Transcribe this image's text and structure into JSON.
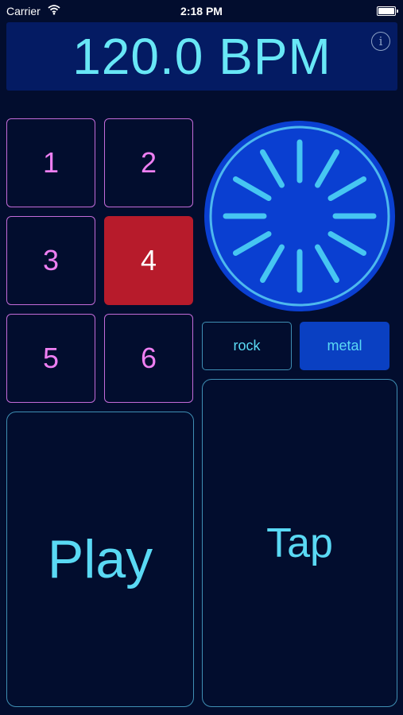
{
  "status_bar": {
    "carrier": "Carrier",
    "time": "2:18 PM",
    "wifi_icon": "wifi-icon",
    "battery_icon": "battery-icon"
  },
  "header": {
    "bpm": "120.0 BPM",
    "info_label": "i",
    "info_icon": "info-circle-icon"
  },
  "patterns": [
    {
      "label": "1",
      "active": false
    },
    {
      "label": "2",
      "active": false
    },
    {
      "label": "3",
      "active": false
    },
    {
      "label": "4",
      "active": true
    },
    {
      "label": "5",
      "active": false
    },
    {
      "label": "6",
      "active": false
    }
  ],
  "styles": [
    {
      "label": "rock",
      "selected": false
    },
    {
      "label": "metal",
      "selected": true
    }
  ],
  "dial": {
    "icon": "beat-spinner-icon",
    "tick_count": 12
  },
  "controls": {
    "play_label": "Play",
    "tap_label": "Tap"
  },
  "colors": {
    "background": "#020d2e",
    "header_bg": "#041b63",
    "bpm_text": "#68e7f6",
    "pad_border": "#c36bd9",
    "pad_text": "#ee7ff2",
    "active_pad": "#b71b2b",
    "control_border": "#3f8fb4",
    "control_text": "#5ad9f4",
    "selected_style": "#0a40c2",
    "dial_fill": "#0a3fd1",
    "dial_ring": "#4db8ee",
    "dial_ticks": "#46c6f2"
  }
}
